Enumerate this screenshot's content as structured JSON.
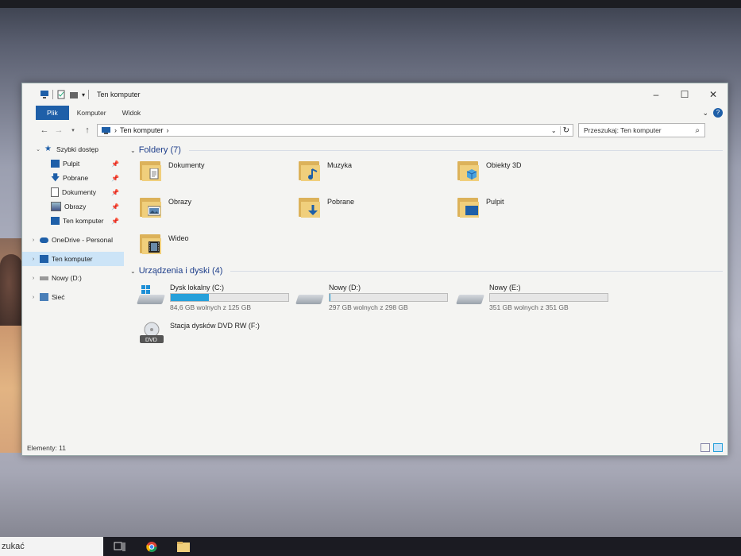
{
  "window": {
    "title": "Ten komputer",
    "controls": [
      "–",
      "☐",
      "✕"
    ]
  },
  "ribbon": {
    "tabs": [
      "Plik",
      "Komputer",
      "Widok"
    ]
  },
  "address": {
    "root_icon": "pc-icon",
    "path": "Ten komputer",
    "sep": "›"
  },
  "search": {
    "placeholder": "Przeszukaj: Ten komputer"
  },
  "sidebar": {
    "quick_access": "Szybki dostęp",
    "items": [
      {
        "label": "Pulpit",
        "icon": "desktop-icon",
        "pinned": true
      },
      {
        "label": "Pobrane",
        "icon": "download-icon",
        "pinned": true
      },
      {
        "label": "Dokumenty",
        "icon": "documents-icon",
        "pinned": true
      },
      {
        "label": "Obrazy",
        "icon": "pictures-icon",
        "pinned": true
      },
      {
        "label": "Ten komputer",
        "icon": "pc-icon",
        "pinned": true
      }
    ],
    "onedrive": "OneDrive - Personal",
    "this_pc": "Ten komputer",
    "drive_d": "Nowy (D:)",
    "network": "Sieć"
  },
  "folders": {
    "header": "Foldery (7)",
    "items": [
      {
        "name": "Dokumenty",
        "icon": "documents-folder-icon"
      },
      {
        "name": "Muzyka",
        "icon": "music-folder-icon"
      },
      {
        "name": "Obiekty 3D",
        "icon": "3d-objects-folder-icon"
      },
      {
        "name": "Obrazy",
        "icon": "pictures-folder-icon"
      },
      {
        "name": "Pobrane",
        "icon": "downloads-folder-icon"
      },
      {
        "name": "Pulpit",
        "icon": "desktop-folder-icon"
      },
      {
        "name": "Wideo",
        "icon": "videos-folder-icon"
      }
    ]
  },
  "drives": {
    "header": "Urządzenia i dyski (4)",
    "items": [
      {
        "name": "Dysk lokalny (C:)",
        "free": "84,6 GB wolnych z 125 GB",
        "used_fraction": 0.323
      },
      {
        "name": "Nowy (D:)",
        "free": "297 GB wolnych z 298 GB",
        "used_fraction": 0.003
      },
      {
        "name": "Nowy (E:)",
        "free": "351 GB wolnych z 351 GB",
        "used_fraction": 0.0
      },
      {
        "name": "Stacja dysków DVD RW (F:)",
        "free": "",
        "used_fraction": null
      }
    ]
  },
  "status": {
    "items": "Elementy: 11"
  },
  "taskbar": {
    "search_text": "zukać"
  },
  "colors": {
    "accent": "#1e5fa8",
    "selection": "#cce4f7",
    "progress": "#26a0da",
    "folder": "#f0cf7c"
  }
}
